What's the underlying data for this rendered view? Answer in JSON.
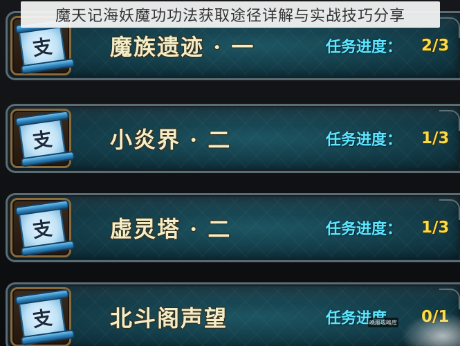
{
  "banner": {
    "title": "魔天记海妖魔功功法获取途径详解与实战技巧分享"
  },
  "tasks": [
    {
      "icon_char": "支",
      "name": "魔族遗迹 · 一",
      "progress_label": "任务进度：",
      "progress_value": "2/3"
    },
    {
      "icon_char": "支",
      "name": "小炎界 · 二",
      "progress_label": "任务进度：",
      "progress_value": "1/3"
    },
    {
      "icon_char": "支",
      "name": "虚灵塔 · 二",
      "progress_label": "任务进度：",
      "progress_value": "1/3"
    },
    {
      "icon_char": "支",
      "name": "北斗阁声望",
      "progress_label": "任务进度",
      "progress_value": "0/1"
    }
  ],
  "watermark": {
    "text": "晚报攻略库"
  },
  "colors": {
    "task_name": "#f3edc8",
    "progress_label": "#5ee5ff",
    "progress_value": "#f7dc4a",
    "row_bg": "#123a46"
  },
  "icons": {
    "task_icon": "scroll-icon"
  }
}
